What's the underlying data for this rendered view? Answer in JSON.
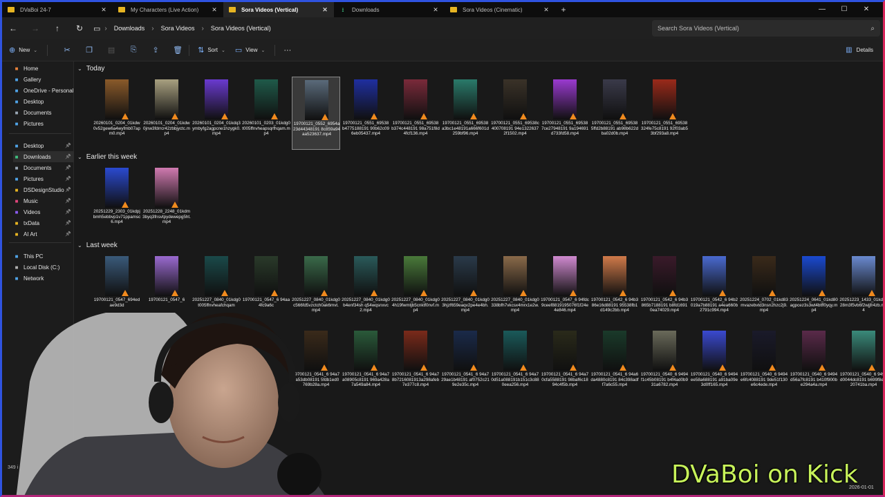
{
  "tabs": [
    {
      "label": "DVaBoi 24-7",
      "icon": "folder-icon",
      "active": false
    },
    {
      "label": "My Characters (Live Action)",
      "icon": "folder-icon",
      "active": false
    },
    {
      "label": "Sora Videos (Vertical)",
      "icon": "folder-icon",
      "active": true
    },
    {
      "label": "Downloads",
      "icon": "download-icon",
      "active": false
    },
    {
      "label": "Sora Videos (Cinematic)",
      "icon": "folder-icon",
      "active": false
    }
  ],
  "address": {
    "crumbs": [
      "Downloads",
      "Sora Videos",
      "Sora Videos (Vertical)"
    ]
  },
  "search": {
    "placeholder": "Search Sora Videos (Vertical)"
  },
  "toolbar": {
    "new_label": "New",
    "sort_label": "Sort",
    "view_label": "View",
    "more_label": "···",
    "details_label": "Details"
  },
  "sidebar": {
    "top": [
      {
        "label": "Home",
        "icon": "home-icon",
        "color": "#e8823b"
      },
      {
        "label": "Gallery",
        "icon": "gallery-icon",
        "color": "#4fa3e6"
      },
      {
        "label": "OneDrive - Personal",
        "icon": "cloud-icon",
        "color": "#4fa3e6"
      },
      {
        "label": "Desktop",
        "icon": "desktop-icon",
        "color": "#4fa3e6"
      },
      {
        "label": "Documents",
        "icon": "document-icon",
        "color": "#9aa7b5"
      },
      {
        "label": "Pictures",
        "icon": "picture-icon",
        "color": "#4fa3e6"
      }
    ],
    "pinned": [
      {
        "label": "Desktop",
        "icon": "desktop-icon",
        "color": "#4fa3e6"
      },
      {
        "label": "Downloads",
        "icon": "download-icon",
        "color": "#3fbf7f"
      },
      {
        "label": "Documents",
        "icon": "document-icon",
        "color": "#9aa7b5"
      },
      {
        "label": "Pictures",
        "icon": "picture-icon",
        "color": "#4fa3e6"
      },
      {
        "label": "DSDesignStudio",
        "icon": "folder-icon",
        "color": "#e6b422"
      },
      {
        "label": "Music",
        "icon": "music-icon",
        "color": "#e0457b"
      },
      {
        "label": "Videos",
        "icon": "video-icon",
        "color": "#8a5cf0"
      },
      {
        "label": "txData",
        "icon": "folder-icon",
        "color": "#e6b422"
      },
      {
        "label": "AI Art",
        "icon": "folder-icon",
        "color": "#e6b422"
      }
    ],
    "bottom": [
      {
        "label": "This PC",
        "icon": "pc-icon",
        "color": "#4fa3e6"
      },
      {
        "label": "Local Disk (C:)",
        "icon": "disk-icon",
        "color": "#b0b0b0"
      },
      {
        "label": "Network",
        "icon": "network-icon",
        "color": "#4fa3e6"
      }
    ]
  },
  "groups": [
    {
      "title": "Today",
      "files": [
        {
          "name": "20260101_0204_01kdw0v52gew6a4wyfmb07apm0.mp4",
          "thumb": "#8a5a2a"
        },
        {
          "name": "20260101_0204_01kdw0jnw3fdrrcr42zbbjyctc.mp4",
          "thumb": "#a8a080"
        },
        {
          "name": "20260101_0204_01kdq3ymbyfg2agpcne1hzygk0.mp4",
          "thumb": "#6a3ad0"
        },
        {
          "name": "20260101_0203_01kdg0t005ffnvheapsqrfhqam.mp4",
          "thumb": "#1f5a4a"
        },
        {
          "name": "19700121_0552_6954a23d44348191 8c859a94aa523637.mp4",
          "thumb": "#5a6a7a"
        },
        {
          "name": "19700121_0551_69538b4775188191 90b62c096eb05437.mp4",
          "thumb": "#1f2fa0"
        },
        {
          "name": "19700121_0551_69538b374c448191 98a751f8d4fcf136.mp4",
          "thumb": "#7a2a3a"
        },
        {
          "name": "19700121_0551_69538a3bc1e48191a666f601d259bf96.mp4",
          "thumb": "#2a7a6a"
        },
        {
          "name": "19700121_0551_69538c400708191 94e13226372f1502.mp4",
          "thumb": "#3a3228"
        },
        {
          "name": "19700121_0551_695387ce27948191 9a194691d733fd58.mp4",
          "thumb": "#9a3ad0"
        },
        {
          "name": "19700121_0551_695385ffd2b88191 ab98b622dba02d0b.mp4",
          "thumb": "#3a3a4a"
        },
        {
          "name": "19700121_0551_69538324fe75c8191 92f03ab53bf293a8.mp4",
          "thumb": "#9a2a1a"
        }
      ]
    },
    {
      "title": "Earlier this week",
      "files": [
        {
          "name": "20251229_2303_01kdpjbmh5ebbvp1v71ppamsc6.mp4",
          "thumb": "#2a4ad0"
        },
        {
          "name": "20251228_2248_01kdm3byq3fnsvtpydewepg5ht.mp4",
          "thumb": "#d07ab0"
        }
      ]
    },
    {
      "title": "Last week",
      "rows": [
        [
          {
            "name": "19700121_0547_694edae9d3d",
            "thumb": "#3a5a7a"
          },
          {
            "name": "19700121_0547_6",
            "thumb": "#9a6ad0"
          },
          {
            "name": "20251227_0840_01kdg0t005ffnvheafchqam",
            "thumb": "#1a4a4a"
          },
          {
            "name": "19700121_0547_6 94aa4fc9a6c",
            "thumb": "#2a3a2a"
          },
          {
            "name": "20251227_0840_01kdg0c566fd5vzctch0ak6mvt.mp4",
            "thumb": "#3a6a4a"
          },
          {
            "name": "20251227_0840_01kdg0b4enf34sh q54wqsnxvc2.mp4",
            "thumb": "#2a5a5a"
          },
          {
            "name": "20251227_0840_01kdg04h19fwmtjb5cnktf0nvf.mp4",
            "thumb": "#4a7a3a"
          },
          {
            "name": "20251227_0840_01kdg03hjzf659eaqv2pe4e4bh.mp4",
            "thumb": "#2a3a4a"
          },
          {
            "name": "20251227_0840_01kdg0338bfh7vkcsx4mrx1e2w.mp4",
            "thumb": "#8a6a4a"
          },
          {
            "name": "19700121_0547_6 94fdc9ceef8819195076f1f24e4e846.mp4",
            "thumb": "#d08ad0"
          },
          {
            "name": "19700121_0542_6 94b386e16d88191 95538fb1d149c2bb.mp4",
            "thumb": "#d07a4a"
          },
          {
            "name": "19700121_0542_6 94b3865b7188191 b8fd16910ea74029.mp4",
            "thumb": "#3a1a2a"
          },
          {
            "name": "19700121_0542_6 94b2019a7b88191 a4ea660b2791c994.mp4",
            "thumb": "#4a6ad0"
          },
          {
            "name": "20251224_0702_01kd83mvazebvtd3nsn2hzc2j9.mp4",
            "thumb": "#3a2a1a"
          },
          {
            "name": "20251224_0641_01kd80agpcez3s3wt4btff0yqy.mp4",
            "thumb": "#1a4ad0"
          },
          {
            "name": "20251223_1433_01kd5c28m3f5vb6f2wjjfr4zb.mp4",
            "thumb": "#6a8ad0"
          }
        ],
        [
          {
            "name": "19700121_0541_6 94a7aa53db08191 5fdb1ed0769b28a.mp4",
            "thumb": "#3a2a1a"
          },
          {
            "name": "19700121_0541_6 94a7a08905c8191 969a428a7a549a84.mp4",
            "thumb": "#2a5a3a"
          },
          {
            "name": "19700121_0541_6 94a78b7216081913a298afeb7e377c8.mp4",
            "thumb": "#7a2a1a"
          },
          {
            "name": "19700121_0541_6 94a729ae1b48191 af0752c219e2e35c.mp4",
            "thumb": "#1a2a4a"
          },
          {
            "name": "19700121_0541_6 94a70d51a088191b151c3c880eea256.mp4",
            "thumb": "#1a5a5a"
          },
          {
            "name": "19700121_0541_6 94a70cfa5588191 98baf6c1894c4f5b.mp4",
            "thumb": "#2a2a1a"
          },
          {
            "name": "19700121_0541_6 94a6da4880c8191 84c398adff7a6c55.mp4",
            "thumb": "#1a3a2a"
          },
          {
            "name": "19700121_0540_6 9494f1c45b08191 b4f4ad0b931a6782.mp4",
            "thumb": "#6a6a5a"
          },
          {
            "name": "19700121_0540_6 9494ee58a688191 a91ba09e3d0ff165.mp4",
            "thumb": "#3a4ad0"
          },
          {
            "name": "19700121_0540_6 9494e6fc4088191 9de51f130e6c4ede.mp4",
            "thumb": "#1a1a2a"
          },
          {
            "name": "19700121_0540_6 9494d56a7fc8191 b410f900be294a4a.mp4",
            "thumb": "#5a2a4a"
          },
          {
            "name": "19700121_0540_6 9494d0044dc8191 b699f8e3f20741ba.mp4",
            "thumb": "#3a8a7a"
          }
        ]
      ]
    }
  ],
  "status": {
    "item_count": "349 i"
  },
  "overlay": {
    "brand_text": "DVaBoi on Kick"
  },
  "tray": {
    "date": "2026-01-01"
  },
  "colors": {
    "accent": "#7fb4ff",
    "frame_left": "#2f53e0",
    "frame_right": "#d9265c",
    "brand": "#c7f25a",
    "vlc_cone": "#f08a1e"
  }
}
